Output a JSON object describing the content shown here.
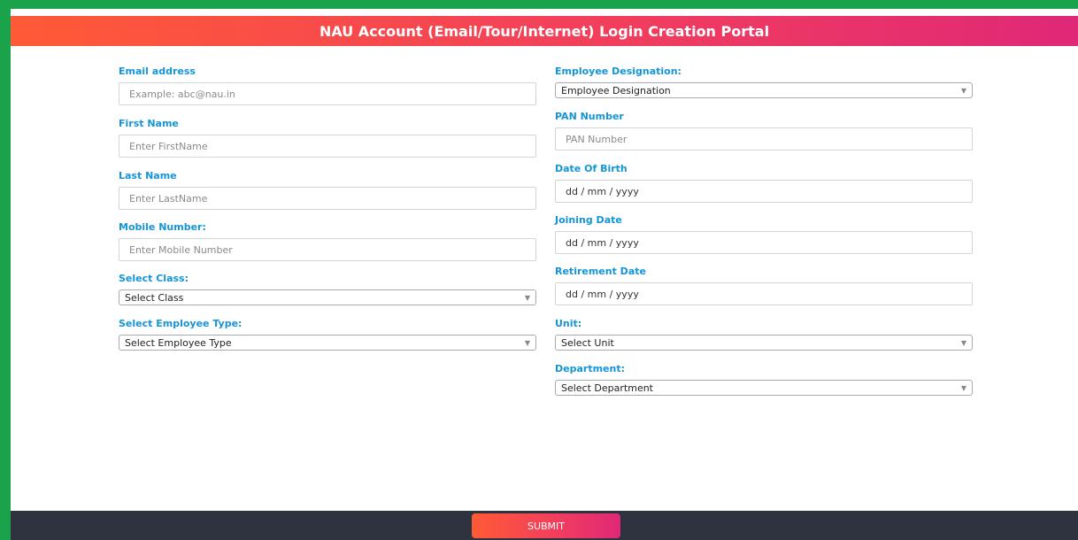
{
  "header": {
    "title": "NAU Account (Email/Tour/Internet) Login Creation Portal"
  },
  "left": {
    "email": {
      "label": "Email address",
      "placeholder": "Example: abc@nau.in"
    },
    "first_name": {
      "label": "First Name",
      "placeholder": "Enter FirstName"
    },
    "last_name": {
      "label": "Last Name",
      "placeholder": "Enter LastName"
    },
    "mobile": {
      "label": "Mobile Number:",
      "placeholder": "Enter Mobile Number"
    },
    "class": {
      "label": "Select Class:",
      "value": "Select Class"
    },
    "employee_type": {
      "label": "Select Employee Type:",
      "value": "Select Employee Type"
    }
  },
  "right": {
    "designation": {
      "label": "Employee Designation:",
      "value": "Employee Designation"
    },
    "pan": {
      "label": "PAN Number",
      "placeholder": "PAN Number"
    },
    "dob": {
      "label": "Date Of Birth",
      "value": "dd / mm / yyyy"
    },
    "joining": {
      "label": "Joining Date",
      "value": "dd / mm / yyyy"
    },
    "retirement": {
      "label": "Retirement Date",
      "value": "dd / mm / yyyy"
    },
    "unit": {
      "label": "Unit:",
      "value": "Select Unit"
    },
    "department": {
      "label": "Department:",
      "value": "Select Department"
    }
  },
  "footer": {
    "submit_label": "SUBMIT"
  },
  "colors": {
    "frame_green": "#1aa34a",
    "label_blue": "#1594d6",
    "gradient_start": "#ff5a36",
    "gradient_end": "#df2877",
    "footer_bg": "#2f3340"
  },
  "icons": {
    "select_chevron": "chevron-down-icon"
  }
}
